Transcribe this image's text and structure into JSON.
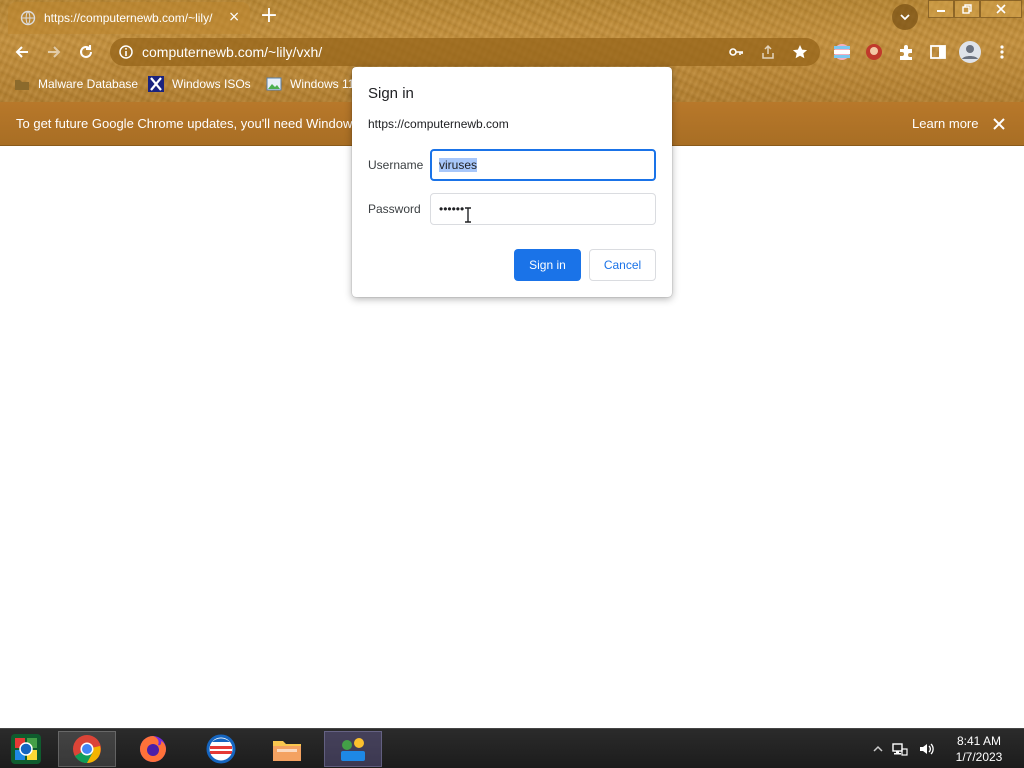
{
  "browser": {
    "tab": {
      "title": "https://computernewb.com/~lily/",
      "close_label": "×"
    },
    "new_tab_label": "+",
    "address": "computernewb.com/~lily/vxh/",
    "bookmarks": [
      {
        "label": "Malware Database",
        "icon": "folder-icon"
      },
      {
        "label": "Windows ISOs",
        "icon": "x-logo-icon"
      },
      {
        "label": "Windows 11",
        "icon": "image-icon"
      }
    ],
    "theme_colors": {
      "frame": "#c7913a",
      "infobar": "#a86e24",
      "accent": "#1a73e8"
    }
  },
  "infobar": {
    "message": "To get future Google Chrome updates, you'll need Windows 1",
    "learn_more": "Learn more"
  },
  "dialog": {
    "title": "Sign in",
    "origin": "https://computernewb.com",
    "username_label": "Username",
    "username_value": "viruses",
    "password_label": "Password",
    "password_value": "••••••",
    "sign_in_label": "Sign in",
    "cancel_label": "Cancel"
  },
  "taskbar": {
    "apps": [
      "chrome-icon",
      "firefox-icon",
      "outlook-icon",
      "file-explorer-icon",
      "network-app-icon"
    ],
    "time": "8:41 AM",
    "date": "1/7/2023"
  }
}
